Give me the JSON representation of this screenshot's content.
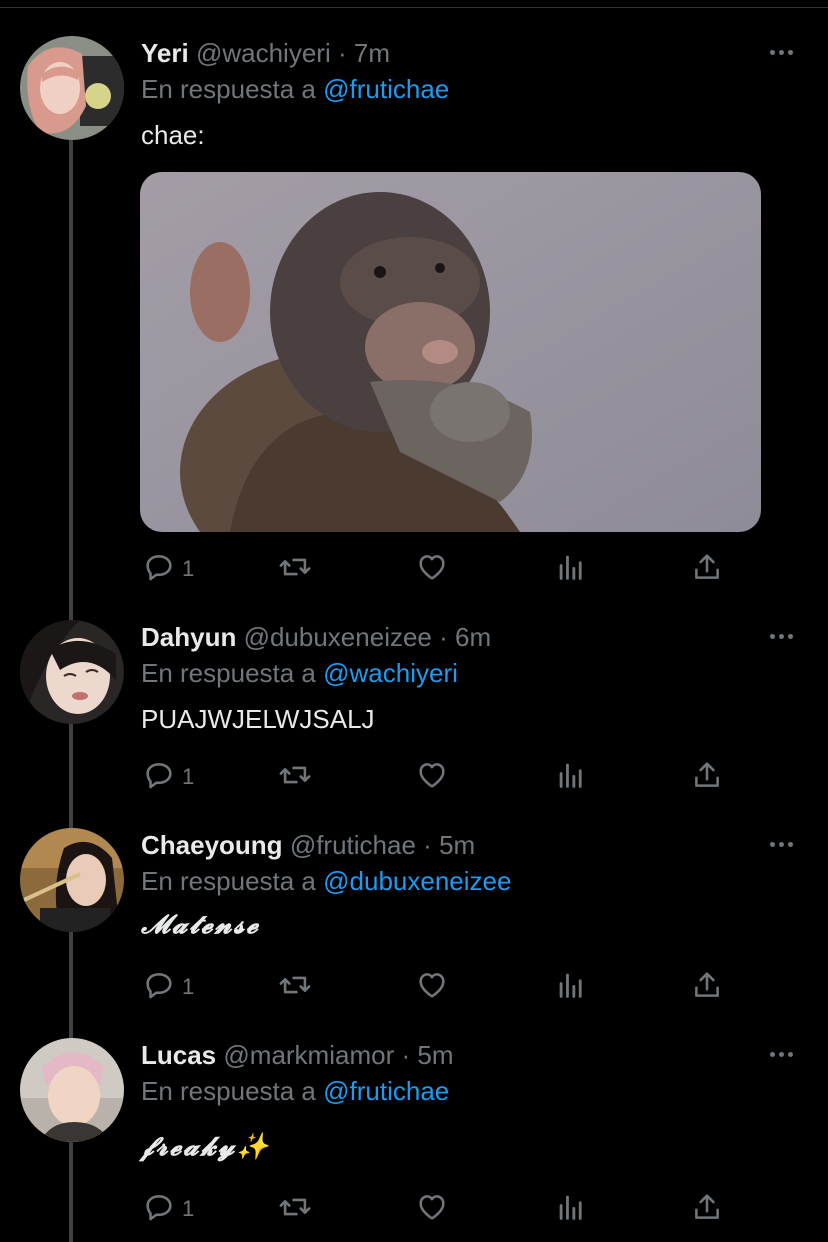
{
  "colors": {
    "background": "#000000",
    "text": "#e7e9ea",
    "secondary": "#71767b",
    "link": "#1d9bf0",
    "thread_line": "#3e4144"
  },
  "reply_prefix": "En respuesta a",
  "tweets": [
    {
      "name": "Yeri",
      "handle": "@wachiyeri",
      "dot": "·",
      "time": "7m",
      "reply_to": "@frutichae",
      "text": "chae:",
      "has_media": true,
      "media_description_icon": "baby-baboon-photo",
      "reply_count": "1"
    },
    {
      "name": "Dahyun",
      "handle": "@dubuxeneizee",
      "dot": "·",
      "time": "6m",
      "reply_to": "@wachiyeri",
      "text": "PUAJWJELWJSALJ",
      "reply_count": "1"
    },
    {
      "name": "Chaeyoung",
      "handle": "@frutichae",
      "dot": "·",
      "time": "5m",
      "reply_to": "@dubuxeneizee",
      "text": "𝓜𝓪𝓽𝓮𝓷𝓼𝓮",
      "reply_count": "1"
    },
    {
      "name": "Lucas",
      "handle": "@markmiamor",
      "dot": "·",
      "time": "5m",
      "reply_to": "@frutichae",
      "text": "𝓯𝓻𝓮𝓪𝓴𝔂✨",
      "reply_count": "1"
    }
  ]
}
